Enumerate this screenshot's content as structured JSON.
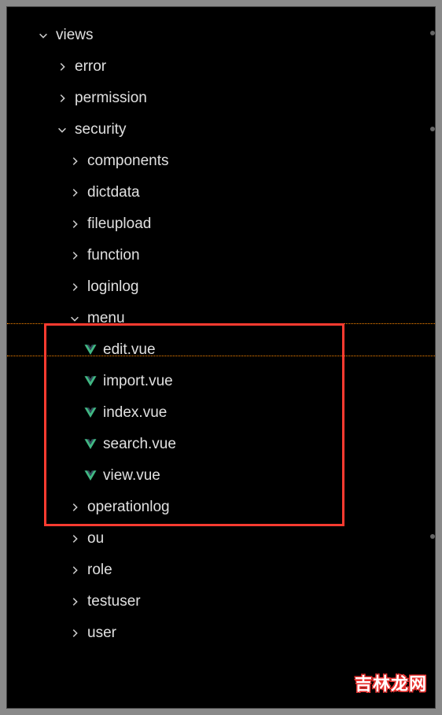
{
  "tree": {
    "root": {
      "label": "views",
      "expanded": true
    },
    "children": [
      {
        "label": "error",
        "expanded": false,
        "depth": 1
      },
      {
        "label": "permission",
        "expanded": false,
        "depth": 1
      },
      {
        "label": "security",
        "expanded": true,
        "depth": 1
      },
      {
        "label": "components",
        "expanded": false,
        "depth": 2
      },
      {
        "label": "dictdata",
        "expanded": false,
        "depth": 2
      },
      {
        "label": "fileupload",
        "expanded": false,
        "depth": 2
      },
      {
        "label": "function",
        "expanded": false,
        "depth": 2
      },
      {
        "label": "loginlog",
        "expanded": false,
        "depth": 2
      },
      {
        "label": "menu",
        "expanded": true,
        "depth": 2,
        "highlighted": true
      },
      {
        "label": "edit.vue",
        "type": "vue",
        "depth": 3
      },
      {
        "label": "import.vue",
        "type": "vue",
        "depth": 3
      },
      {
        "label": "index.vue",
        "type": "vue",
        "depth": 3
      },
      {
        "label": "search.vue",
        "type": "vue",
        "depth": 3
      },
      {
        "label": "view.vue",
        "type": "vue",
        "depth": 3
      },
      {
        "label": "operationlog",
        "expanded": false,
        "depth": 2
      },
      {
        "label": "ou",
        "expanded": false,
        "depth": 2
      },
      {
        "label": "role",
        "expanded": false,
        "depth": 2
      },
      {
        "label": "testuser",
        "expanded": false,
        "depth": 2
      },
      {
        "label": "user",
        "expanded": false,
        "depth": 2
      }
    ]
  },
  "watermark": "吉林龙网"
}
